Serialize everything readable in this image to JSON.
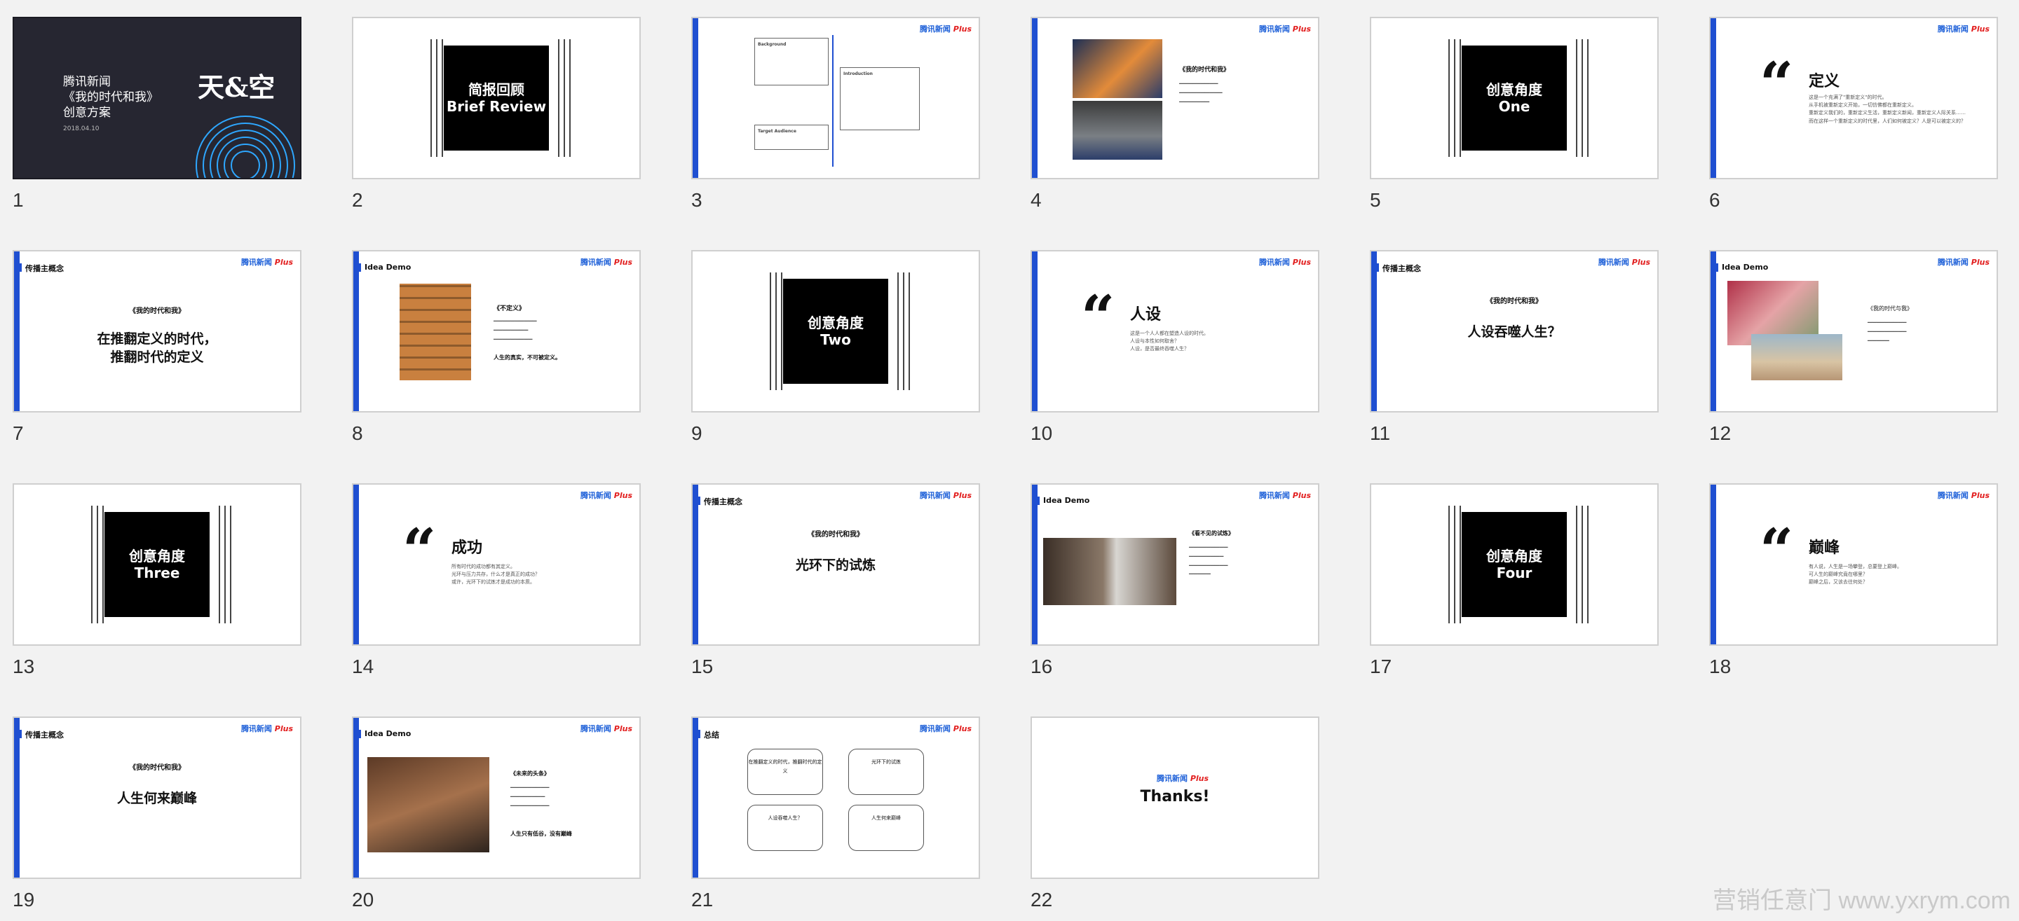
{
  "slides": [
    {
      "num": "1",
      "title": "腾讯新闻",
      "subtitle": "《我的时代和我》",
      "line3": "创意方案",
      "date": "2018.04.10",
      "brand": "天&空"
    },
    {
      "num": "2",
      "line1": "简报回顾",
      "line2": "Brief Review"
    },
    {
      "num": "3",
      "labels": [
        "Background",
        "Introduction",
        "Target Audience"
      ]
    },
    {
      "num": "4",
      "heading": "《我的时代和我》"
    },
    {
      "num": "5",
      "line1": "创意角度",
      "line2": "One"
    },
    {
      "num": "6",
      "heading": "定义",
      "body": [
        "这是一个充满了\"重新定义\"的时代。",
        "从手机被重新定义开始，一切仿佛都在重新定义。",
        "重新定义我们的，重新定义生活，重新定义新闻，重新定义人际关系……",
        "而在这样一个重新定义的时代里，人们如何被定义？人是可以被定义的？"
      ]
    },
    {
      "num": "7",
      "section": "传播主概念",
      "heading": "《我的时代和我》",
      "line1": "在推翻定义的时代，",
      "line2": "推翻时代的定义"
    },
    {
      "num": "8",
      "section": "Idea Demo",
      "heading": "《不定义》",
      "tagline": "人生的真实，不可被定义。"
    },
    {
      "num": "9",
      "line1": "创意角度",
      "line2": "Two"
    },
    {
      "num": "10",
      "heading": "人设",
      "body": [
        "这是一个人人都在塑造人设的时代。",
        "人设与本性如何取舍？",
        "人设，是否最终吞噬人生？"
      ]
    },
    {
      "num": "11",
      "section": "传播主概念",
      "heading": "《我的时代和我》",
      "line1": "人设吞噬人生？"
    },
    {
      "num": "12",
      "section": "Idea Demo",
      "heading": "《我的时代与我》"
    },
    {
      "num": "13",
      "line1": "创意角度",
      "line2": "Three"
    },
    {
      "num": "14",
      "heading": "成功",
      "body": [
        "所有时代的成功都有其定义。",
        "光环与压力共存，什么才是真正的成功？",
        "或许，光环下的试炼才是成功的本质。"
      ]
    },
    {
      "num": "15",
      "section": "传播主概念",
      "heading": "《我的时代和我》",
      "line1": "光环下的试炼"
    },
    {
      "num": "16",
      "section": "Idea Demo",
      "heading": "《看不见的试炼》"
    },
    {
      "num": "17",
      "line1": "创意角度",
      "line2": "Four"
    },
    {
      "num": "18",
      "heading": "巅峰",
      "body": [
        "有人说，人生是一场攀登，总要登上巅峰。",
        "可人生的巅峰究竟在哪里？",
        "巅峰之后，又该去往何处？"
      ]
    },
    {
      "num": "19",
      "section": "传播主概念",
      "heading": "《我的时代和我》",
      "line1": "人生何来巅峰"
    },
    {
      "num": "20",
      "section": "Idea Demo",
      "heading": "《未来的头条》",
      "tagline": "人生只有低谷，没有巅峰"
    },
    {
      "num": "21",
      "section": "总结",
      "pills": [
        "在推翻定义的时代，推翻时代的定义",
        "光环下的试炼",
        "人设吞噬人生？",
        "人生何来巅峰"
      ]
    },
    {
      "num": "22",
      "thanks": "Thanks!"
    }
  ],
  "logo": {
    "text": "腾讯新闻",
    "accent": "Plus"
  },
  "watermark": "营销任意门 www.yxrym.com",
  "colors": {
    "accent": "#1f4fd1",
    "dark": "#262631",
    "brand_red": "#e21e1e"
  }
}
